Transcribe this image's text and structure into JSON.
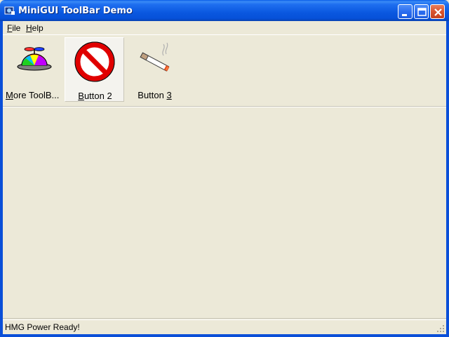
{
  "window": {
    "title": "MiniGUI ToolBar Demo",
    "colors": {
      "titlebar": "#0a58e0",
      "face": "#ece9d8",
      "close": "#d9532d"
    }
  },
  "menu": {
    "items": [
      {
        "prefix": "",
        "accel": "F",
        "rest": "ile"
      },
      {
        "prefix": "",
        "accel": "H",
        "rest": "elp"
      }
    ]
  },
  "toolbar": {
    "buttons": [
      {
        "prefix": "",
        "accel": "M",
        "rest": "ore ToolB...",
        "icon": "propeller-hat-icon"
      },
      {
        "prefix": "",
        "accel": "B",
        "rest": "utton 2",
        "icon": "no-sign-icon"
      },
      {
        "prefix": "Button ",
        "accel": "3",
        "rest": "",
        "icon": "cigarette-icon"
      }
    ]
  },
  "statusbar": {
    "text": "HMG Power Ready!"
  }
}
